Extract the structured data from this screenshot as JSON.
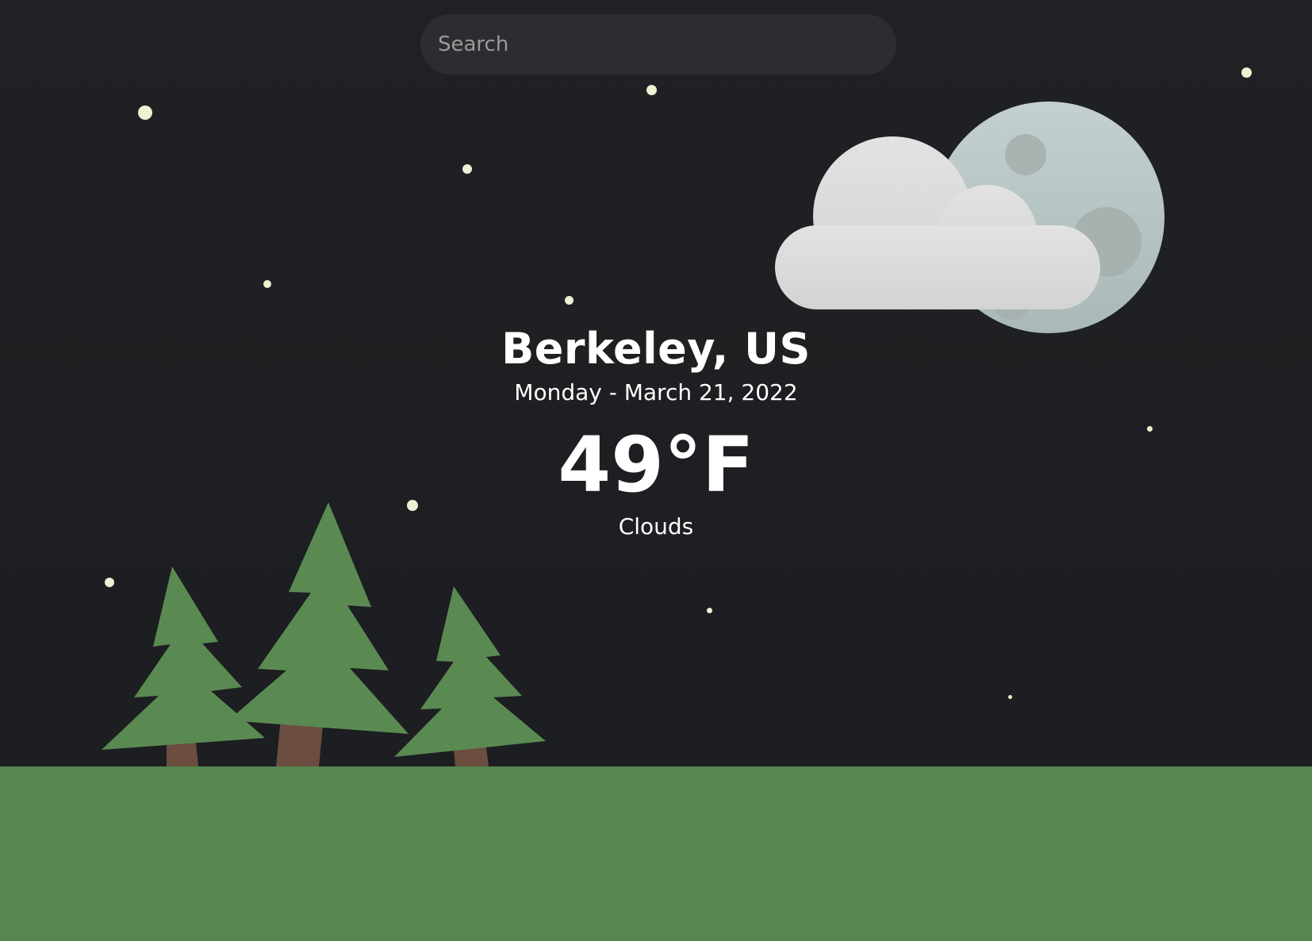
{
  "search": {
    "placeholder": "Search"
  },
  "weather": {
    "location": "Berkeley, US",
    "date": "Monday - March 21, 2022",
    "temperature": "49°F",
    "condition": "Clouds"
  },
  "scene": {
    "icon": "moon-cloud-icon",
    "trees_icon": "pine-trees-icon"
  },
  "colors": {
    "background": "#1c1e21",
    "search_bg": "#2c2d30",
    "star": "#eef2d2",
    "ground": "#55874f",
    "tree": "#5a8a52",
    "trunk": "#6b4e3f",
    "cloud": "#dedede",
    "moon": "#bcccca"
  }
}
